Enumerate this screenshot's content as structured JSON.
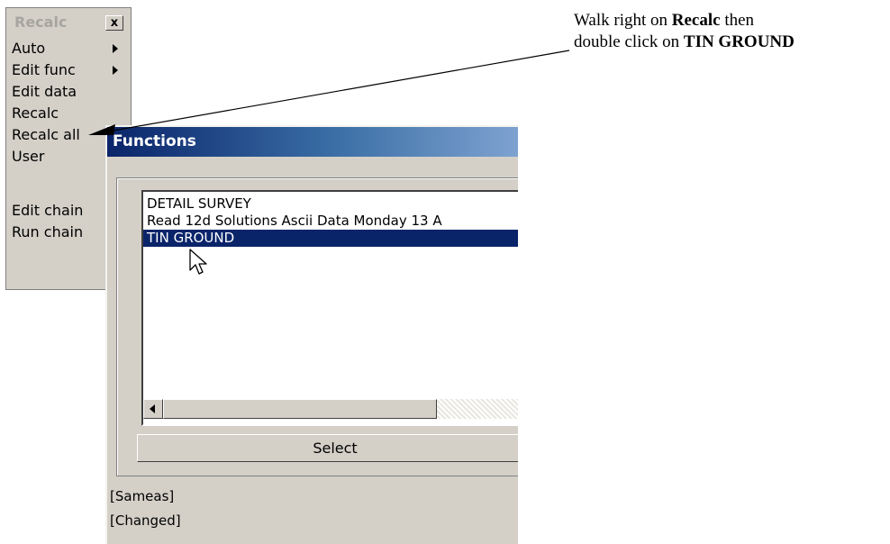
{
  "menu": {
    "title": "Recalc",
    "close_label": "x",
    "items": [
      {
        "label": "Auto",
        "submenu": true
      },
      {
        "label": "Edit func",
        "submenu": true
      },
      {
        "label": "Edit data",
        "submenu": false
      },
      {
        "label": "Recalc",
        "submenu": false
      },
      {
        "label": "Recalc all",
        "submenu": false
      },
      {
        "label": "User",
        "submenu": false
      },
      {
        "label": "Edit chain",
        "submenu": false
      },
      {
        "label": "Run chain",
        "submenu": false
      }
    ]
  },
  "dialog": {
    "title": "Functions",
    "list_items": [
      {
        "label": "DETAIL SURVEY",
        "selected": false
      },
      {
        "label": "Read 12d Solutions Ascii Data Monday 13 A",
        "selected": false
      },
      {
        "label": "TIN GROUND",
        "selected": true
      }
    ],
    "select_button": "Select",
    "status_lines": [
      "[Sameas]",
      "[Changed]"
    ]
  },
  "annotation": {
    "line1_prefix": "Walk right on ",
    "line1_bold": "Recalc",
    "line1_suffix": " then",
    "line2_prefix": "double click on ",
    "line2_bold": "TIN GROUND"
  },
  "colors": {
    "selection": "#0a246a",
    "titlebar_start": "#0a246a",
    "titlebar_end": "#7ea2d0",
    "panel": "#d4d0c8"
  }
}
